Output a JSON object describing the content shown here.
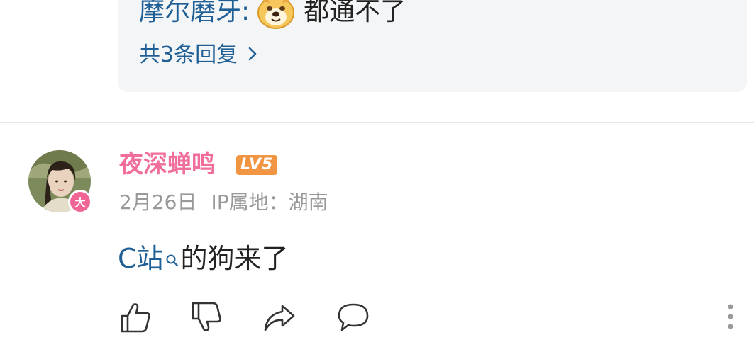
{
  "reply_preview": {
    "author": "摩尔磨牙",
    "colon": ":",
    "emoji_icon": "doge-emoji-icon",
    "text": "都通不了",
    "more_label": "共3条回复"
  },
  "comment": {
    "username": "夜深蝉鸣",
    "level": "LV5",
    "avatar_badge": "大",
    "date": "2月26日",
    "ip_location": "IP属地：湖南",
    "content_link": "C站",
    "content_text": "的狗来了",
    "actions": {
      "like_icon": "thumbs-up-icon",
      "dislike_icon": "thumbs-down-icon",
      "share_icon": "share-icon",
      "reply_icon": "comment-bubble-icon",
      "more_icon": "more-vertical-icon"
    }
  },
  "colors": {
    "username": "#f06e9c",
    "link": "#1f5f95",
    "level_badge": "#f29543",
    "avatar_badge": "#f06595",
    "meta_text": "#999999",
    "reply_box_bg": "#f4f5f7"
  }
}
